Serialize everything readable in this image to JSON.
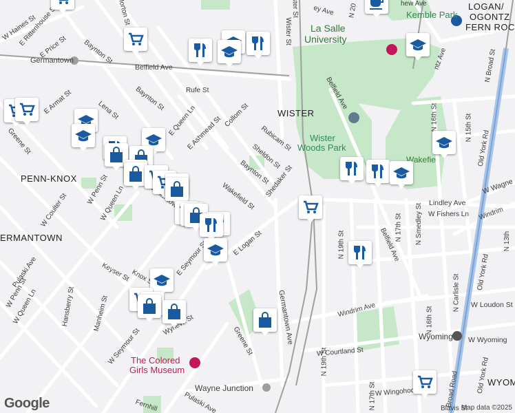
{
  "map": {
    "colors": {
      "background": "#f2f1f4",
      "park": "#c6e8c8",
      "road": "#ffffff",
      "major_road": "#a8c4e6",
      "rail": "#a0a0a0",
      "poi": "#1a5aa0"
    },
    "places": {
      "wister": "WISTER",
      "penn_knox": "PENN-KNOX",
      "germantown_area": "ERMANTOWN",
      "logan": "LOGAN/",
      "ogontz": "OGONTZ",
      "fern_rock": "FERN ROC",
      "wyoming_area": "WYOM"
    },
    "parks": {
      "kemble": "Kemble Park",
      "wister_woods_1": "Wister",
      "wister_woods_2": "Woods Park",
      "lasalle_1": "La Salle",
      "lasalle_2": "University"
    },
    "landmarks": {
      "museum_1": "The Colored",
      "museum_2": "Girls Museum",
      "germantown_station": "Germantown",
      "wayne_junction": "Wayne Junction",
      "wyoming_station": "Wyoming",
      "wakefield": "Wakefie"
    },
    "streets": {
      "haines": "W Haines St",
      "rittenhouse": "E Rittenhouse St",
      "price": "E Price St",
      "baynton_1": "Baynton St",
      "baynton_2": "Baynton St",
      "baynton_3": "Baynton St",
      "morton": "Morton St",
      "belfield_1": "Belfield Ave",
      "belfield_2": "Belfield Ave",
      "belfield_3": "Belfield Ave",
      "wister_st": "Wister St",
      "rufe": "Rufe St",
      "armat": "E Armat St",
      "lena": "Lena St",
      "queen_ln_e": "E Queen Ln",
      "ashmead": "E Ashmead St",
      "collom": "Collom St",
      "rubicam": "Rubicam St",
      "sheldon": "Sheldon St",
      "shedaker": "Shedaker St",
      "wakefield": "Wakefield St",
      "logan_e": "E Logan St",
      "greene_1": "Greene St",
      "greene_2": "Greene St",
      "penn_w": "W Penn St",
      "penn_w2": "W Penn St",
      "queen_w": "W Queen Ln",
      "queen_w2": "W Queen Ln",
      "coulter": "W Coulter St",
      "germantown_ave": "Germantown Ave",
      "germantown_ave2": "Germantown Ave",
      "seymour_e": "E Seymour St",
      "seymour_w": "W Seymour St",
      "keyser": "Keyser St",
      "knox": "Knox St",
      "pulaski": "Pulaski Ave",
      "pulaski2": "Pulaski Ave",
      "hansberry": "Hansberry St",
      "manheim": "Manheim St",
      "wyneva": "Wyneva St",
      "windrim": "Windrim Ave",
      "windrim2": "Windrim",
      "lindley": "Lindley Ave",
      "fishers": "W Fishers Ln",
      "loudon": "W Loudon St",
      "wyoming_w": "W Wyoming",
      "courtland": "W Courtland St",
      "wingohocking": "W Wingohocking St",
      "broad": "N Broad St",
      "old_york_1": "Old York Rd",
      "old_york_2": "Old York Rd",
      "n19th_1": "N 19th St",
      "n19th_2": "N 19th St",
      "n17th_1": "N 17th St",
      "n17th_2": "N 17th St",
      "n16th_1": "N 16th St",
      "n16th_2": "N 16th St",
      "n15th": "N 15th St",
      "n13th": "N 13th",
      "carlisle": "N Carlisle St",
      "smedley": "N Smedley St",
      "wagner": "W Wagne",
      "broad_road": "Broad Road",
      "sixteenth_top": "N 20",
      "wister_ave_top": "ey Ave",
      "chew": "hew Ave",
      "blavis": "Blavis St",
      "fernhill": "Fernhill",
      "pulaski_bottom": "Pulaski Ave",
      "wister_st2": "Wister St",
      "ontz": "ntz Ave"
    },
    "google_logo": "Google",
    "attribution": "Map data ©2025"
  }
}
